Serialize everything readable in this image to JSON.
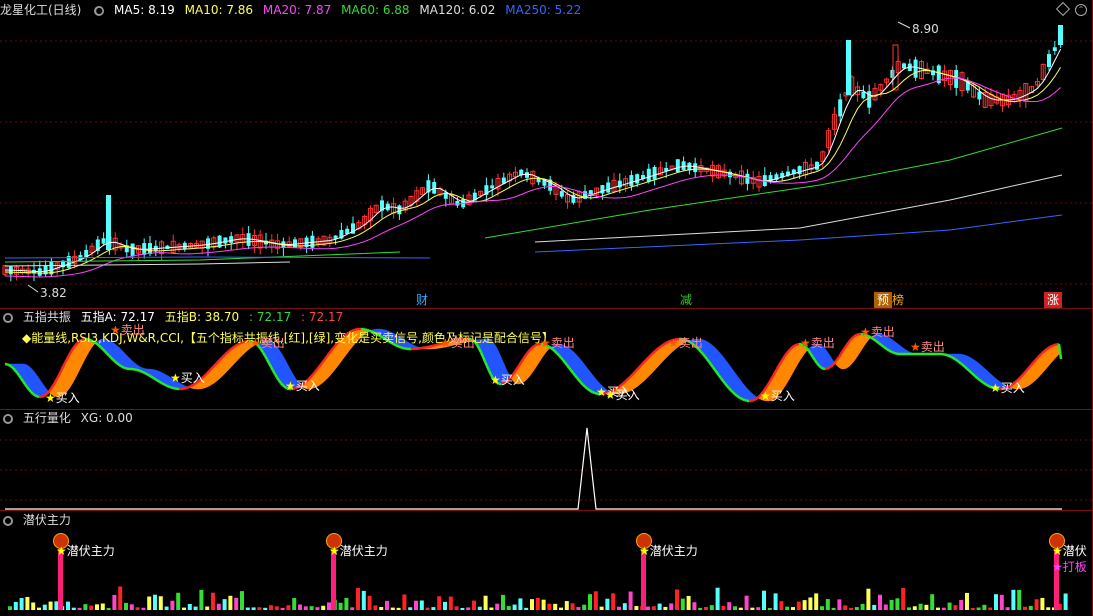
{
  "main": {
    "title": "龙星化工(日线)",
    "ma": [
      {
        "label": "MA5: 8.19",
        "color": "#ffffff"
      },
      {
        "label": "MA10: 7.86",
        "color": "#ffff55"
      },
      {
        "label": "MA20: 7.87",
        "color": "#ff44ff"
      },
      {
        "label": "MA60: 6.88",
        "color": "#33dd33"
      },
      {
        "label": "MA120: 6.02",
        "color": "#dddddd"
      },
      {
        "label": "MA250: 5.22",
        "color": "#3366ff"
      }
    ],
    "high_label": "8.90",
    "low_label": "3.82",
    "events": [
      {
        "label": "财",
        "bg": "#000000",
        "fg": "#33aaff"
      },
      {
        "label": "减",
        "bg": "#000000",
        "fg": "#33cc33"
      },
      {
        "label": "预",
        "bg": "#b06000",
        "fg": "#ffffff"
      },
      {
        "label": "榜",
        "bg": "#000000",
        "fg": "#ffaa00"
      },
      {
        "label": "涨",
        "bg": "#cc2222",
        "fg": "#ffffff"
      }
    ]
  },
  "wuzhi": {
    "title": "五指共振",
    "a_label": "五指A: 72.17",
    "b_label": "五指B: 38.70",
    "v1": ": 72.17",
    "v2": ": 72.17",
    "note": "◆能量线,RSI3,KDJ,W&R,CCI,【五个指标共振线,[红],[绿],变化是买卖信号,颜色及标记是配合信号】",
    "buy": "买入",
    "sell": "卖出"
  },
  "wuxing": {
    "title": "五行量化",
    "xg": "XG: 0.00"
  },
  "qianfu": {
    "title": "潜伏主力",
    "mark": "潜伏主力",
    "mark_short": "潜伏",
    "daban": "打板"
  }
}
